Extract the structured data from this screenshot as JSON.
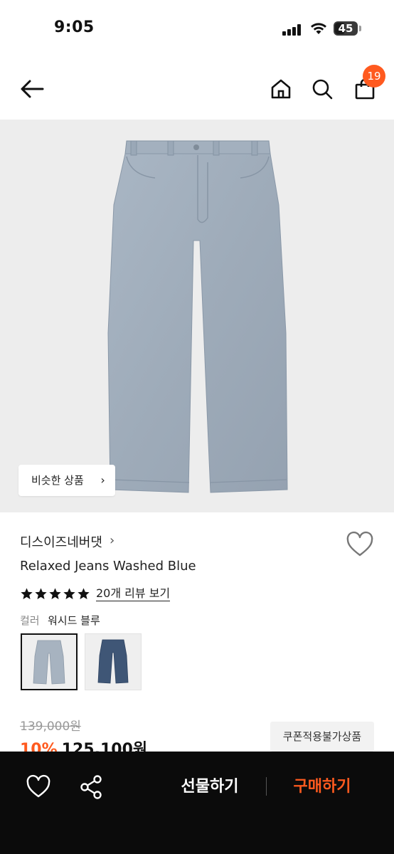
{
  "status_bar": {
    "time": "9:05",
    "battery": "45",
    "battery_level": 0.45
  },
  "header": {
    "cart_count": "19"
  },
  "product_image": {
    "similar_label": "비슷한 상품",
    "chevron": "›"
  },
  "product": {
    "brand": "디스이즈네버댓",
    "brand_chevron": "›",
    "name": "Relaxed Jeans Washed Blue",
    "rating": 5,
    "review_link": "20개 리뷰 보기",
    "color_label": "컬러",
    "color_value": "워시드 블루",
    "swatches": [
      "washed-blue",
      "dark-indigo"
    ],
    "selected_swatch": 0
  },
  "price": {
    "original": "139,000원",
    "discount": "10%",
    "sale": "125,100원",
    "coupon_note": "쿠폰적용불가상품"
  },
  "bottom_bar": {
    "gift_label": "선물하기",
    "buy_label": "구매하기"
  },
  "colors": {
    "accent": "#ff5a1f",
    "bottom_bar_bg": "#0b0b0b",
    "image_bg": "#ededed"
  },
  "icons": [
    "back-arrow-icon",
    "home-icon",
    "search-icon",
    "shopping-bag-icon",
    "heart-icon",
    "share-icon",
    "star-icon"
  ]
}
